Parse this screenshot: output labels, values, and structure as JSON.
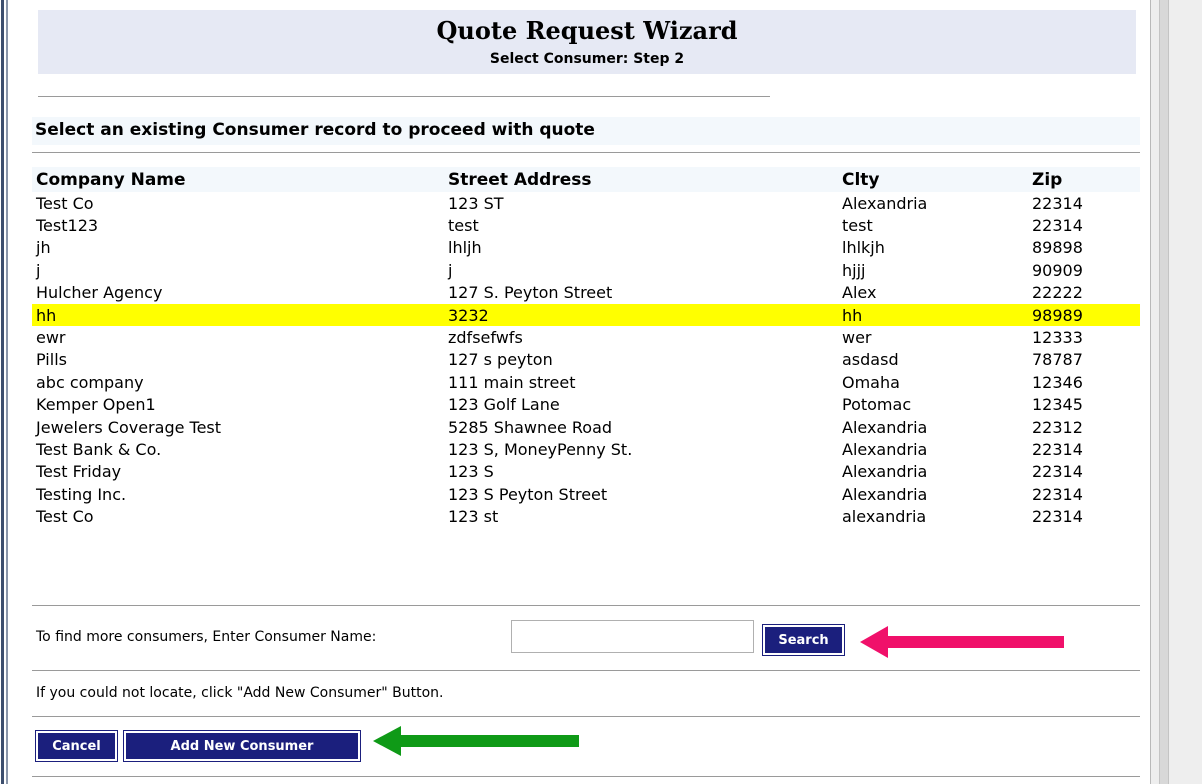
{
  "wizard": {
    "title": "Quote Request Wizard",
    "subtitle": "Select Consumer: Step 2"
  },
  "section_title": "Select an existing Consumer record to proceed with quote",
  "table": {
    "columns": [
      "Company Name",
      "Street Address",
      "Clty",
      "Zip"
    ],
    "rows": [
      [
        "Test Co",
        "123 ST",
        "Alexandria",
        "22314"
      ],
      [
        "Test123",
        "test",
        "test",
        "22314"
      ],
      [
        "jh",
        "lhljh",
        "lhlkjh",
        "89898"
      ],
      [
        "j",
        "j",
        "hjjj",
        "90909"
      ],
      [
        "Hulcher Agency",
        "127 S. Peyton Street",
        "Alex",
        "22222"
      ],
      [
        "hh",
        "3232",
        "hh",
        "98989"
      ],
      [
        "ewr",
        "zdfsefwfs",
        "wer",
        "12333"
      ],
      [
        "Pills",
        "127 s peyton",
        "asdasd",
        "78787"
      ],
      [
        "abc company",
        "111 main street",
        "Omaha",
        "12346"
      ],
      [
        "Kemper Open1",
        "123 Golf Lane",
        "Potomac",
        "12345"
      ],
      [
        "Jewelers Coverage Test",
        "5285 Shawnee Road",
        "Alexandria",
        "22312"
      ],
      [
        "Test Bank & Co.",
        "123 S, MoneyPenny St.",
        "Alexandria",
        "22314"
      ],
      [
        "Test Friday",
        "123 S",
        "Alexandria",
        "22314"
      ],
      [
        "Testing Inc.",
        "123 S Peyton Street",
        "Alexandria",
        "22314"
      ],
      [
        "Test Co",
        "123 st",
        "alexandria",
        "22314"
      ]
    ],
    "highlighted_row": 5,
    "highlight_color": "#ffff00"
  },
  "search": {
    "label": "To find more consumers, Enter Consumer Name:",
    "value": "",
    "button_label": "Search"
  },
  "info_text": "If you could not locate, click \"Add New Consumer\" Button.",
  "actions": {
    "cancel_label": "Cancel",
    "add_label": "Add New Consumer"
  },
  "annotations": {
    "search_arrow_color": "#f0106a",
    "add_arrow_color": "#0f9a17"
  },
  "colors": {
    "button_bg": "#1b1f7d",
    "header_bg": "#e6e9f4"
  }
}
